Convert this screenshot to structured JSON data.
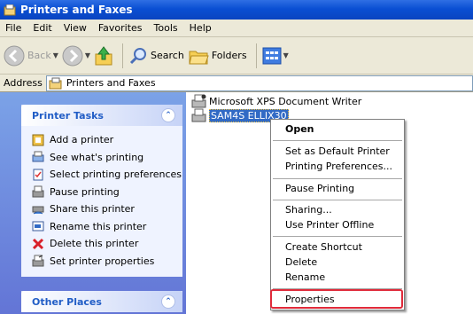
{
  "window": {
    "title": "Printers and Faxes"
  },
  "menu": [
    "File",
    "Edit",
    "View",
    "Favorites",
    "Tools",
    "Help"
  ],
  "toolbar": {
    "back_label": "Back",
    "search_label": "Search",
    "folders_label": "Folders"
  },
  "address": {
    "label": "Address",
    "value": "Printers and Faxes"
  },
  "printer_tasks": {
    "title": "Printer Tasks",
    "items": [
      {
        "label": "Add a printer",
        "icon": "add-printer-icon"
      },
      {
        "label": "See what's printing",
        "icon": "print-queue-icon"
      },
      {
        "label": "Select printing preferences",
        "icon": "preferences-icon"
      },
      {
        "label": "Pause printing",
        "icon": "pause-printer-icon"
      },
      {
        "label": "Share this printer",
        "icon": "share-printer-icon"
      },
      {
        "label": "Rename this printer",
        "icon": "rename-icon"
      },
      {
        "label": "Delete this printer",
        "icon": "delete-x-icon"
      },
      {
        "label": "Set printer properties",
        "icon": "printer-properties-icon"
      }
    ]
  },
  "other_places": {
    "title": "Other Places"
  },
  "printers": [
    {
      "name": "Microsoft XPS Document Writer"
    },
    {
      "name": "SAM4S ELLIX30",
      "selected": true
    }
  ],
  "context_menu": {
    "open": "Open",
    "set_default": "Set as Default Printer",
    "preferences": "Printing Preferences...",
    "pause": "Pause Printing",
    "sharing": "Sharing...",
    "offline": "Use Printer Offline",
    "create_shortcut": "Create Shortcut",
    "delete": "Delete",
    "rename": "Rename",
    "properties": "Properties"
  },
  "colors": {
    "title_bar": "#0a4fd3",
    "task_pane": "#6375d6",
    "selection": "#316ac5",
    "highlight_box": "#e02a3a"
  }
}
